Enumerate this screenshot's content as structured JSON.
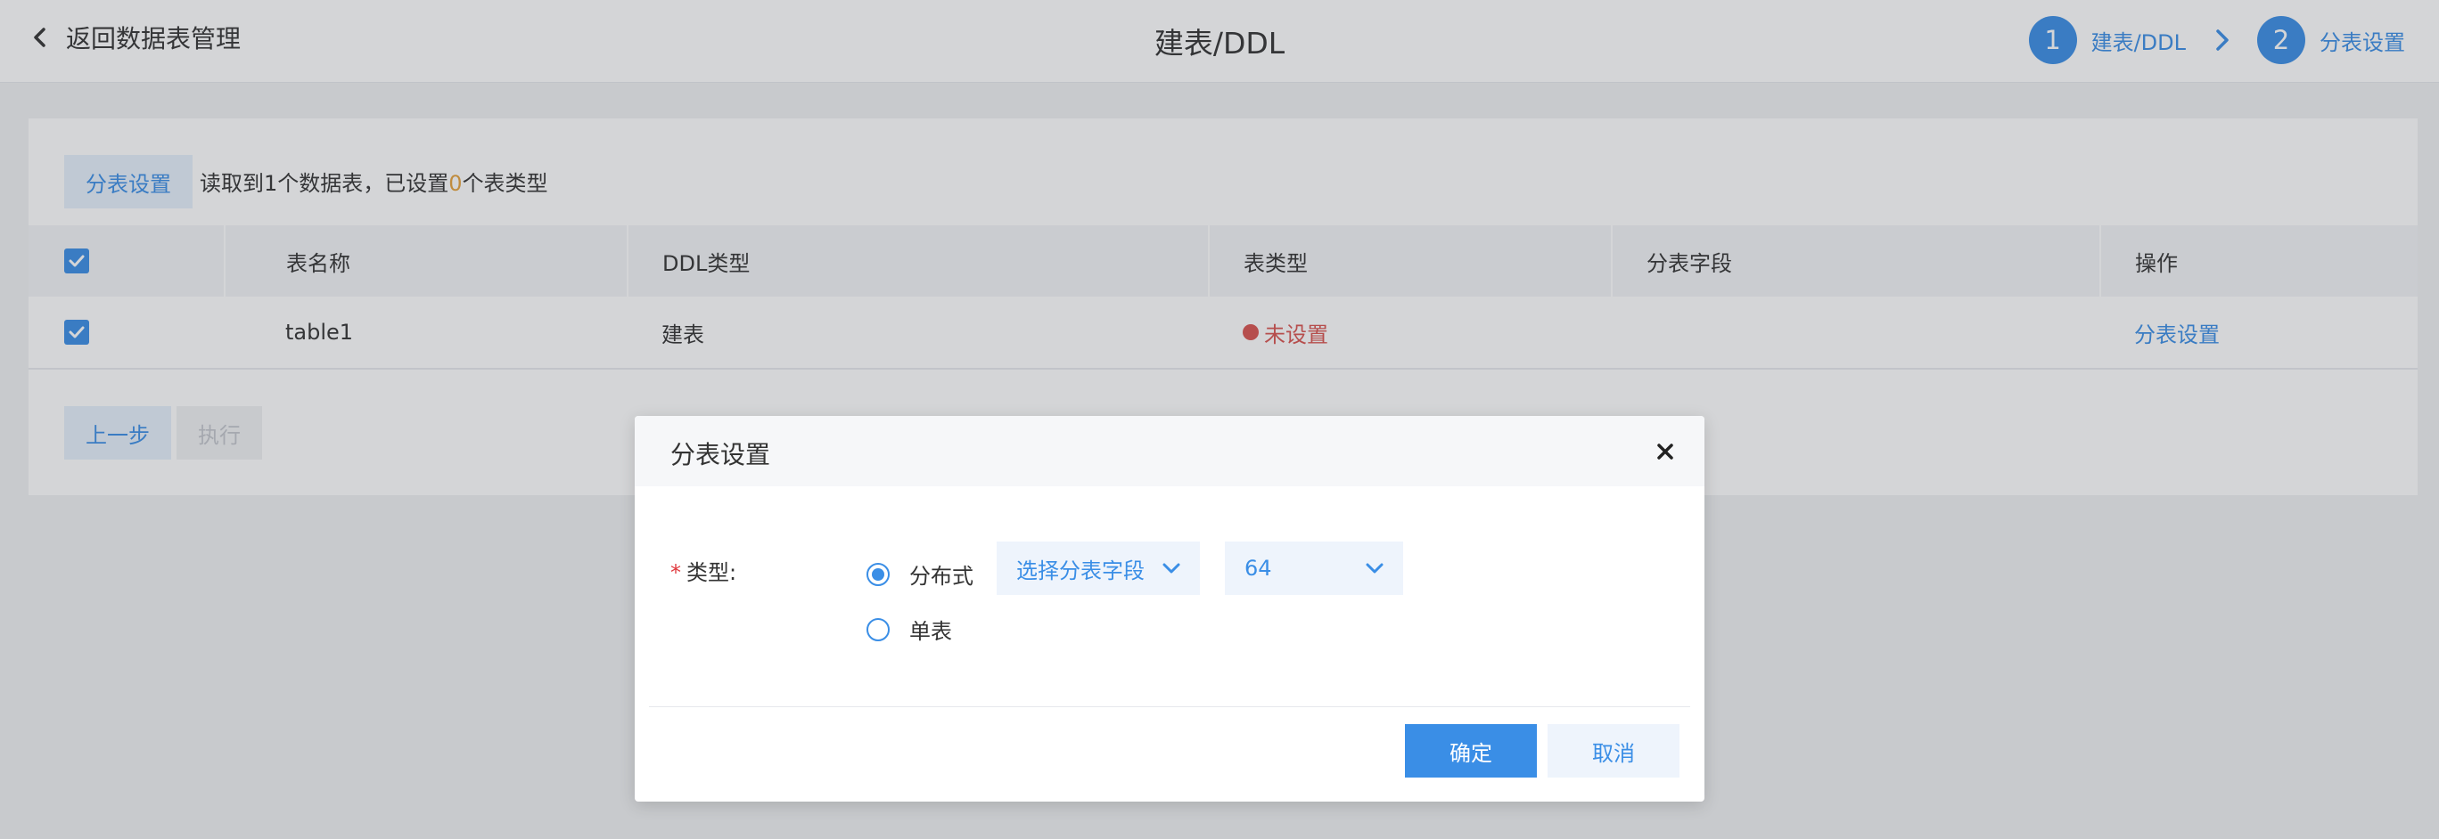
{
  "header": {
    "back_label": "返回数据表管理",
    "title": "建表/DDL",
    "steps": [
      {
        "number": "1",
        "label": "建表/DDL"
      },
      {
        "number": "2",
        "label": "分表设置"
      }
    ]
  },
  "toolbar": {
    "set_button_label": "分表设置",
    "summary_prefix": "读取到1个数据表，已设置",
    "summary_count": "0",
    "summary_suffix": "个表类型"
  },
  "table": {
    "columns": [
      "表名称",
      "DDL类型",
      "表类型",
      "分表字段",
      "操作"
    ],
    "rows": [
      {
        "checked": true,
        "name": "table1",
        "ddl_type": "建表",
        "table_type": "未设置",
        "shard_field": "",
        "action": "分表设置"
      }
    ]
  },
  "footer": {
    "prev_label": "上一步",
    "run_label": "执行"
  },
  "dialog": {
    "title": "分表设置",
    "field_label": "类型:",
    "required_mark": "*",
    "options": [
      {
        "label": "分布式",
        "selected": true
      },
      {
        "label": "单表",
        "selected": false
      }
    ],
    "shard_field_select": "选择分表字段",
    "shard_count_select": "64",
    "ok_label": "确定",
    "cancel_label": "取消"
  },
  "colors": {
    "accent": "#3a8ee6",
    "status_unset": "#d9534f",
    "count_highlight": "#e6a23c"
  }
}
